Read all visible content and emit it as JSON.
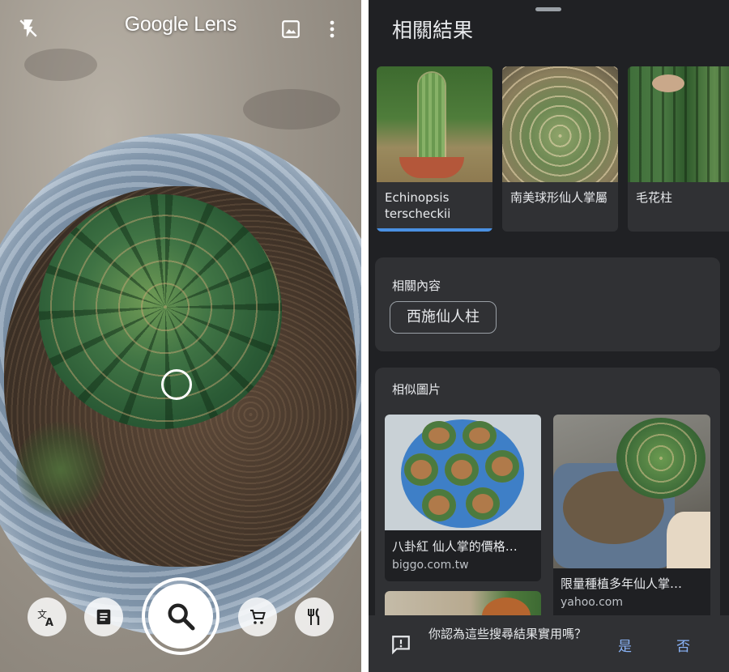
{
  "camera": {
    "title": "Google Lens",
    "icons": {
      "flash": "flash-off-icon",
      "gallery": "gallery-icon",
      "more": "more-vert-icon"
    },
    "modes": [
      "translate",
      "text",
      "search",
      "shopping",
      "dining"
    ]
  },
  "results": {
    "title": "相關結果",
    "related": [
      {
        "label": "Echinopsis terscheckii",
        "selected": true
      },
      {
        "label": "南美球形仙人掌屬",
        "selected": false
      },
      {
        "label": "毛花柱",
        "selected": false
      }
    ],
    "related_content": {
      "heading": "相關內容",
      "chip": "西施仙人柱"
    },
    "similar": {
      "heading": "相似圖片",
      "items": [
        {
          "title": "八卦紅 仙人掌的價格…",
          "source": "biggo.com.tw"
        },
        {
          "title": "限量種植多年仙人掌…",
          "source": "yahoo.com"
        }
      ]
    },
    "feedback": {
      "question": "你認為這些搜尋結果實用嗎？",
      "yes": "是",
      "no": "否"
    },
    "colors": {
      "background": "#202124",
      "card": "#303134",
      "accent": "#4a90e2",
      "link": "#8ab4f8"
    }
  }
}
